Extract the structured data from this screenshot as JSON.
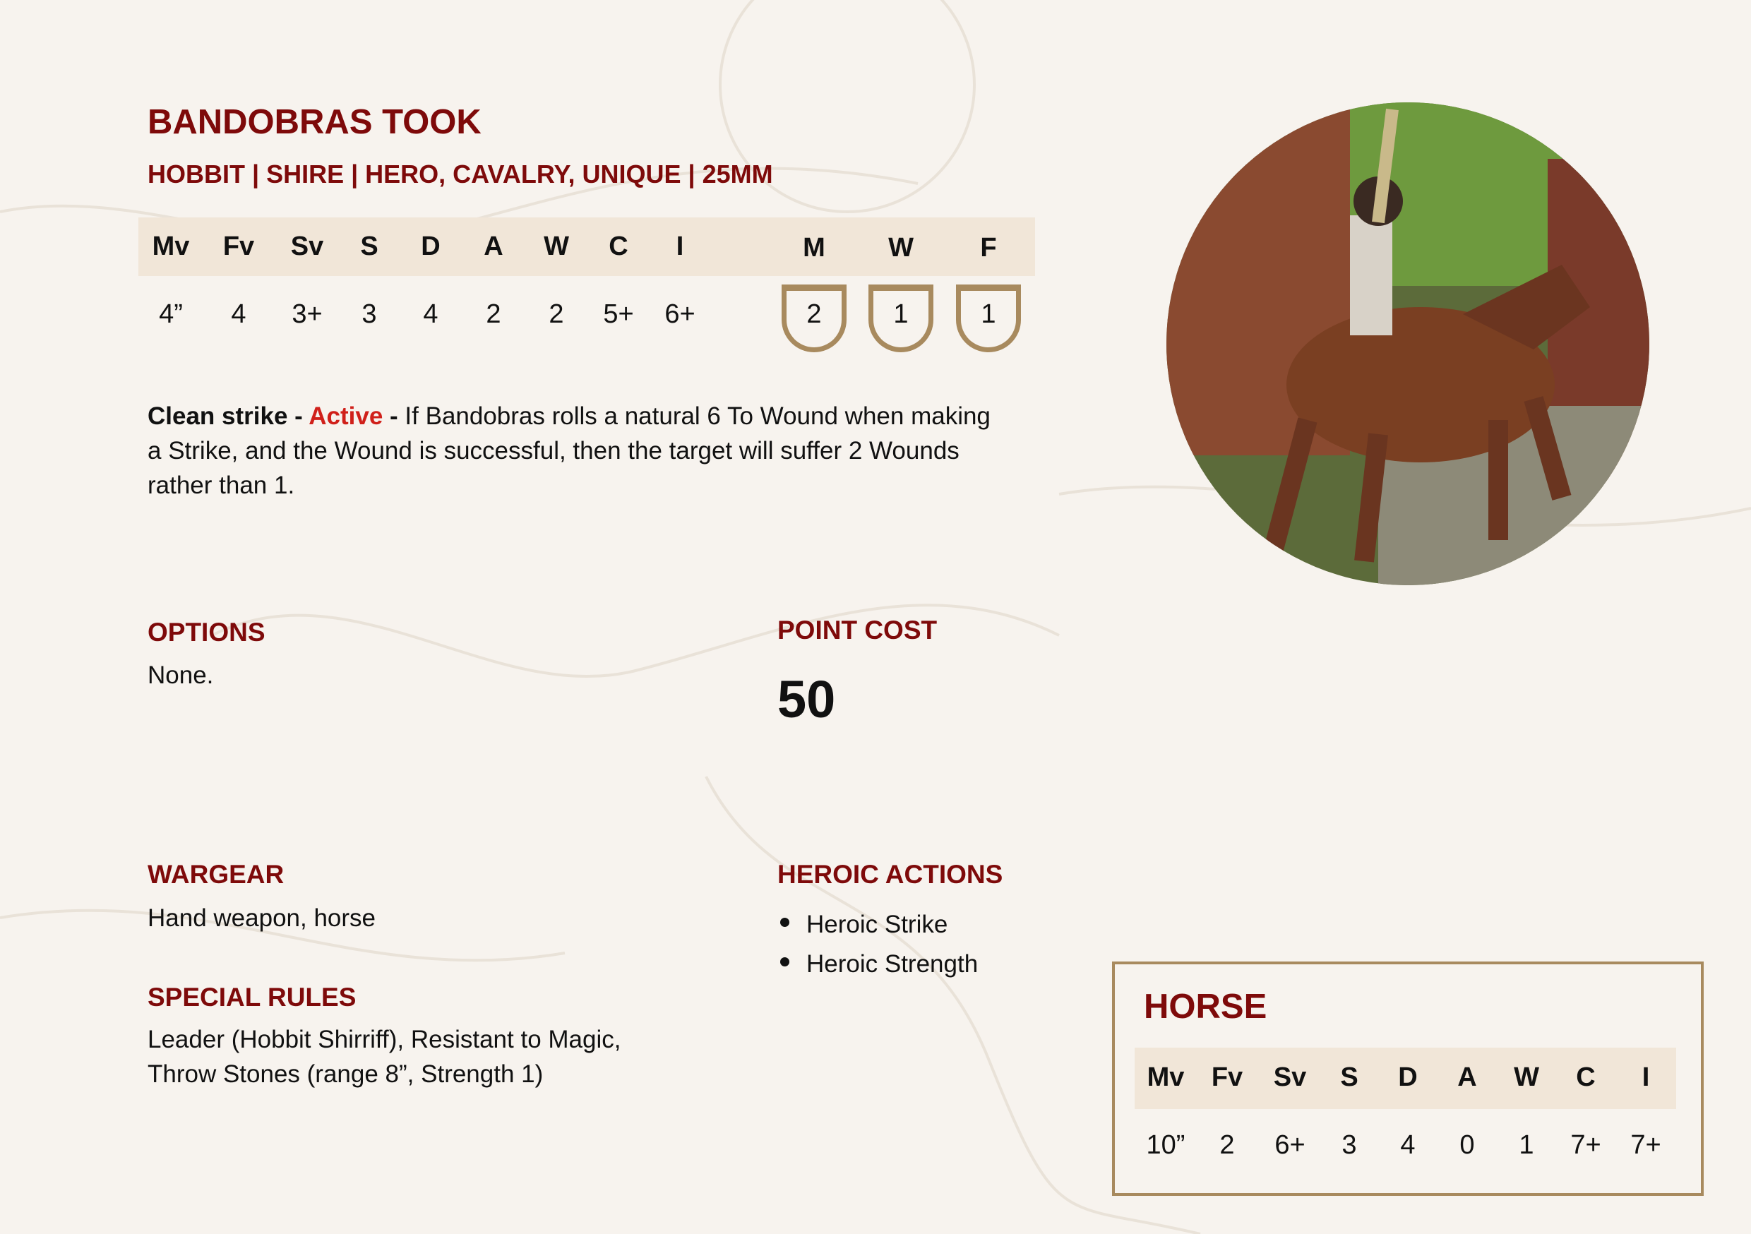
{
  "profile": {
    "name": "BANDOBRAS TOOK",
    "keywords": "HOBBIT | SHIRE | HERO, CAVALRY, UNIQUE  | 25MM",
    "stat_headers": [
      "Mv",
      "Fv",
      "Sv",
      "S",
      "D",
      "A",
      "W",
      "C",
      "I"
    ],
    "stat_values": [
      "4”",
      "4",
      "3+",
      "3",
      "4",
      "2",
      "2",
      "5+",
      "6+"
    ],
    "hero_headers": [
      "M",
      "W",
      "F"
    ],
    "hero_values": [
      "2",
      "1",
      "1"
    ]
  },
  "rule": {
    "name": "Clean strike",
    "sep1": " - ",
    "type": "Active",
    "sep2": " - ",
    "text": "If Bandobras rolls a natural 6 To Wound when making a Strike, and the Wound is successful, then the target will suffer 2 Wounds rather than 1."
  },
  "options": {
    "heading": "OPTIONS",
    "text": "None."
  },
  "point_cost": {
    "heading": "POINT COST",
    "value": "50"
  },
  "wargear": {
    "heading": "WARGEAR",
    "text": "Hand weapon, horse"
  },
  "special_rules": {
    "heading": "SPECIAL RULES",
    "text": "Leader (Hobbit Shirriff), Resistant to Magic, Throw Stones (range 8”, Strength 1)"
  },
  "heroic_actions": {
    "heading": "HEROIC ACTIONS",
    "items": [
      "Heroic Strike",
      "Heroic Strength"
    ]
  },
  "horse": {
    "title": "HORSE",
    "stat_headers": [
      "Mv",
      "Fv",
      "Sv",
      "S",
      "D",
      "A",
      "W",
      "C",
      "I"
    ],
    "stat_values": [
      "10”",
      "2",
      "6+",
      "3",
      "4",
      "0",
      "1",
      "7+",
      "7+"
    ]
  },
  "colors": {
    "accent_red": "#7e0a0a",
    "active_red": "#d0201a",
    "gold": "#a88a5e",
    "bar": "#f1e6d8",
    "paper": "#f7f3ee"
  }
}
